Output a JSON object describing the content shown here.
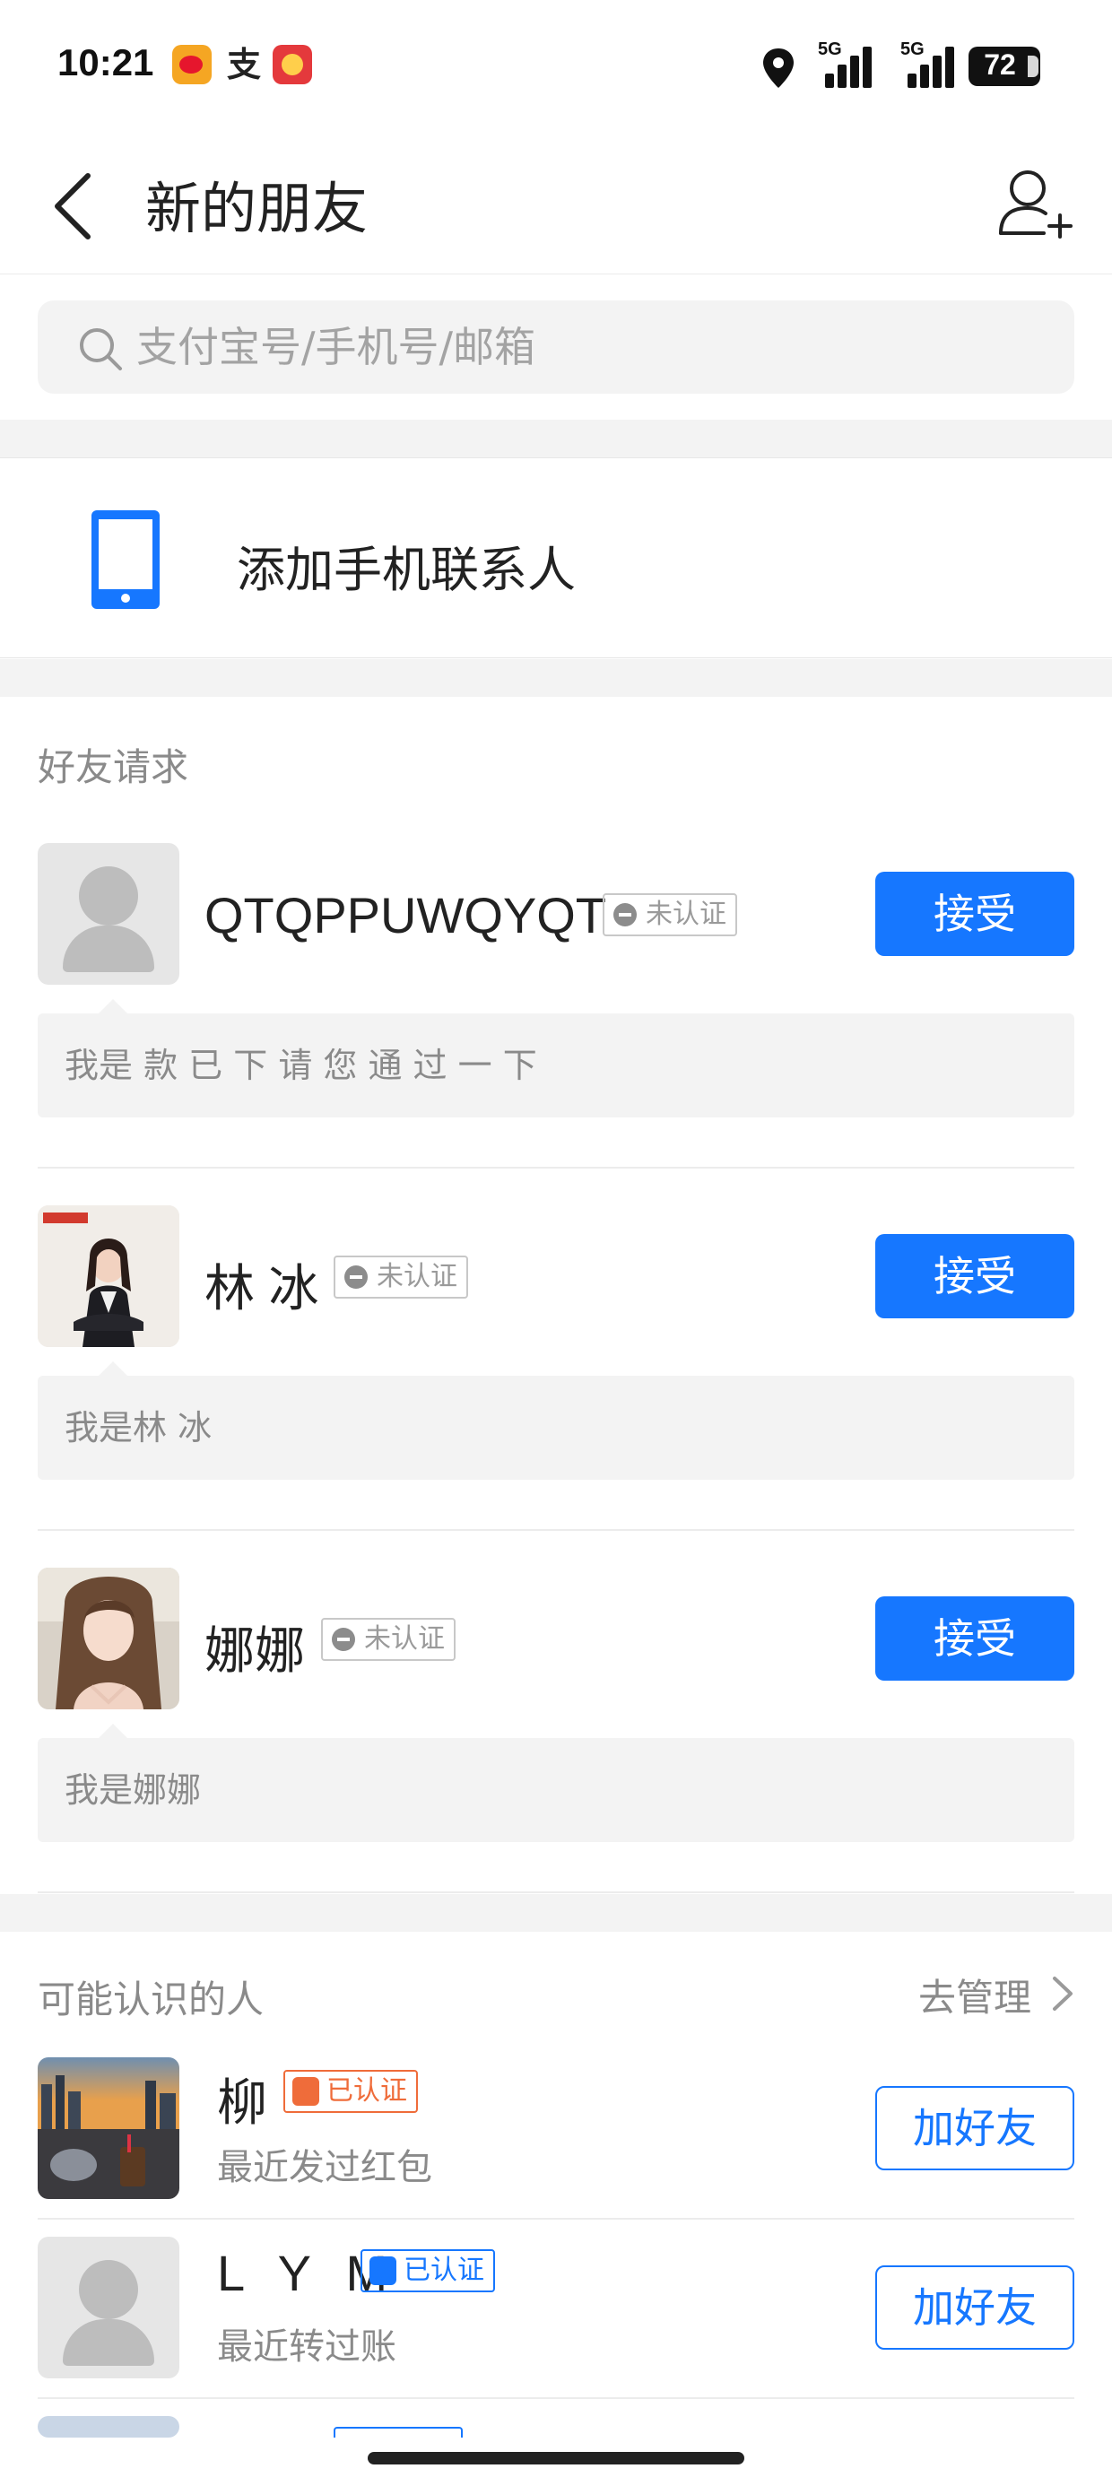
{
  "status_bar": {
    "time": "10:21",
    "net1": "5G",
    "net2": "5G",
    "battery": "72",
    "notif_app2": "支"
  },
  "nav": {
    "title": "新的朋友"
  },
  "search": {
    "placeholder": "支付宝号/手机号/邮箱"
  },
  "add_contacts": {
    "label": "添加手机联系人"
  },
  "requests": {
    "title": "好友请求",
    "items": [
      {
        "name": "QTQPPUWQYQT",
        "badge": "未认证",
        "button": "接受",
        "message": "我是 款 已 下 请 您 通 过 一 下"
      },
      {
        "name": "林 冰",
        "badge": "未认证",
        "button": "接受",
        "message": "我是林 冰"
      },
      {
        "name": "娜娜",
        "badge": "未认证",
        "button": "接受",
        "message": "我是娜娜"
      }
    ]
  },
  "people": {
    "title": "可能认识的人",
    "manage": "去管理",
    "items": [
      {
        "name": "柳",
        "badge": "已认证",
        "sub": "最近发过红包",
        "button": "加好友"
      },
      {
        "name": "L Y M",
        "badge": "已认证",
        "sub": "最近转过账",
        "button": "加好友"
      }
    ]
  },
  "colors": {
    "accent": "#1677ff",
    "verified_orange": "#ef6c3a",
    "gray_text": "#8a8a8a"
  }
}
